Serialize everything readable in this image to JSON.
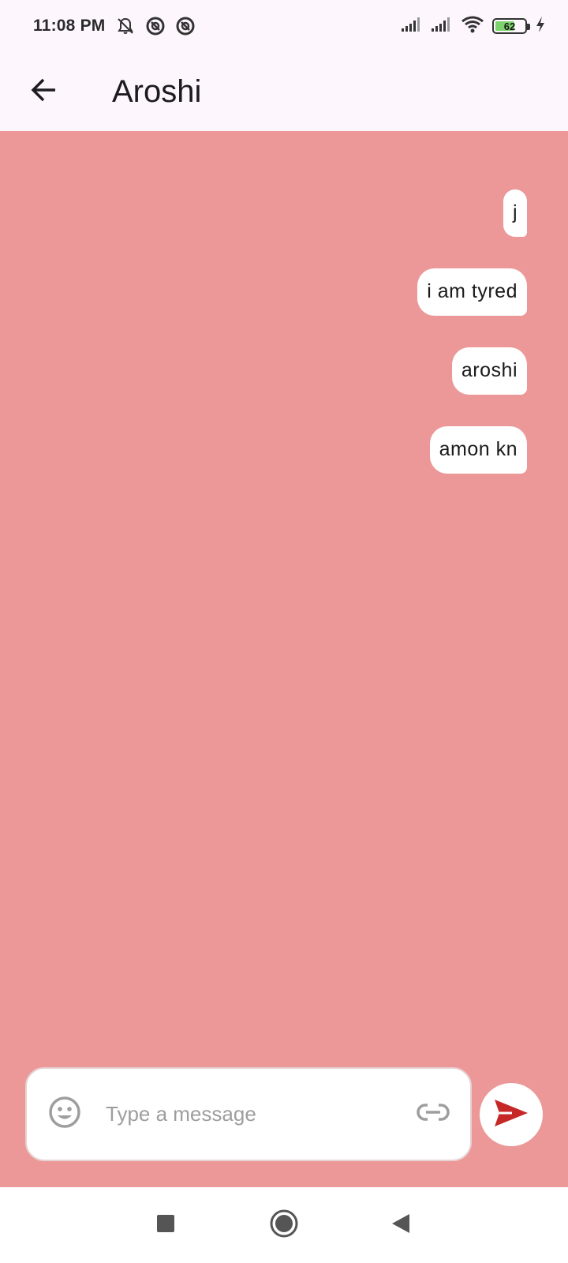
{
  "status_bar": {
    "time": "11:08 PM",
    "battery_level": "62",
    "icons": [
      "bell-off-icon",
      "sync-icon",
      "sync-icon",
      "signal-icon",
      "signal-icon",
      "wifi-icon",
      "battery-icon",
      "charging-icon"
    ]
  },
  "app_bar": {
    "title": "Aroshi",
    "back_icon": "arrow-back-icon"
  },
  "chat": {
    "background_color": "#ec9898",
    "messages": [
      {
        "text": "j",
        "sender": "me"
      },
      {
        "text": "i am tyred",
        "sender": "me"
      },
      {
        "text": "aroshi",
        "sender": "me"
      },
      {
        "text": "amon kn",
        "sender": "me"
      }
    ]
  },
  "composer": {
    "placeholder": "Type a message",
    "value": "",
    "emoji_icon": "emoji-icon",
    "attach_icon": "link-icon",
    "send_icon": "send-icon",
    "send_color": "#c62828"
  },
  "nav_bar": {
    "icons": [
      "recent-apps-icon",
      "home-icon",
      "back-icon"
    ]
  }
}
